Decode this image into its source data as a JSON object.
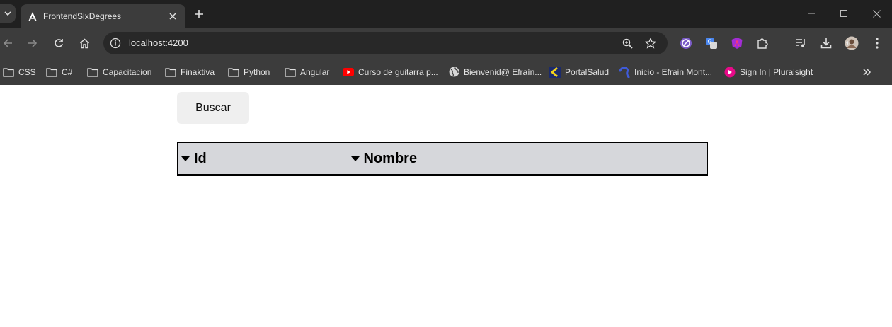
{
  "browser": {
    "tab": {
      "title": "FrontendSixDegrees"
    },
    "address": {
      "url": "localhost:4200"
    },
    "bookmarks": [
      {
        "label": "CSS",
        "icon": "folder-icon"
      },
      {
        "label": "C#",
        "icon": "folder-icon"
      },
      {
        "label": "Capacitacion",
        "icon": "folder-icon"
      },
      {
        "label": "Finaktiva",
        "icon": "folder-icon"
      },
      {
        "label": "Python",
        "icon": "folder-icon"
      },
      {
        "label": "Angular",
        "icon": "folder-icon"
      },
      {
        "label": "Curso de guitarra p...",
        "icon": "youtube-icon"
      },
      {
        "label": "Bienvenid@ Efraín...",
        "icon": "globe-icon"
      },
      {
        "label": "PortalSalud",
        "icon": "portalsalud-icon"
      },
      {
        "label": "Inicio - Efrain Mont...",
        "icon": "site-icon"
      },
      {
        "label": "Sign In | Pluralsight",
        "icon": "pluralsight-icon"
      }
    ]
  },
  "page": {
    "search_button": "Buscar",
    "table": {
      "headers": [
        "Id",
        "Nombre"
      ]
    }
  },
  "colors": {
    "tab_strip": "#202020",
    "toolbar": "#3c3c3c",
    "table_header_bg": "#d6d7db",
    "button_bg": "#efefef"
  }
}
